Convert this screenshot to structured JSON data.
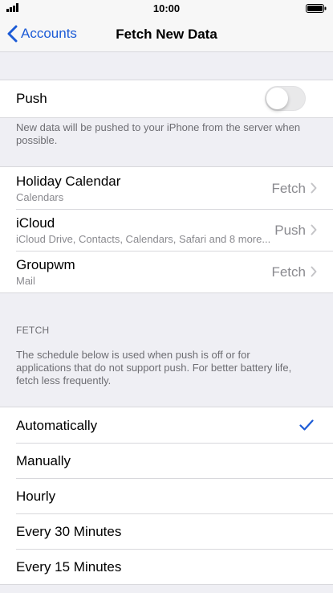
{
  "status_bar": {
    "time": "10:00"
  },
  "nav": {
    "back_label": "Accounts",
    "title": "Fetch New Data"
  },
  "push": {
    "label": "Push",
    "enabled": false,
    "description": "New data will be pushed to your iPhone from the server when possible."
  },
  "accounts": [
    {
      "name": "Holiday Calendar",
      "detail": "Calendars",
      "value": "Fetch"
    },
    {
      "name": "iCloud",
      "detail": "iCloud Drive, Contacts, Calendars, Safari and 8 more...",
      "value": "Push"
    },
    {
      "name": "Groupwm",
      "detail": "Mail",
      "value": "Fetch"
    }
  ],
  "fetch": {
    "header": "FETCH",
    "description": "The schedule below is used when push is off or for applications that do not support push. For better battery life, fetch less frequently.",
    "options": [
      {
        "label": "Automatically",
        "selected": true
      },
      {
        "label": "Manually",
        "selected": false
      },
      {
        "label": "Hourly",
        "selected": false
      },
      {
        "label": "Every 30 Minutes",
        "selected": false
      },
      {
        "label": "Every 15 Minutes",
        "selected": false
      }
    ]
  },
  "colors": {
    "accent": "#1c5bd6",
    "background": "#efeff4",
    "secondary_text": "#8a8a8f"
  }
}
